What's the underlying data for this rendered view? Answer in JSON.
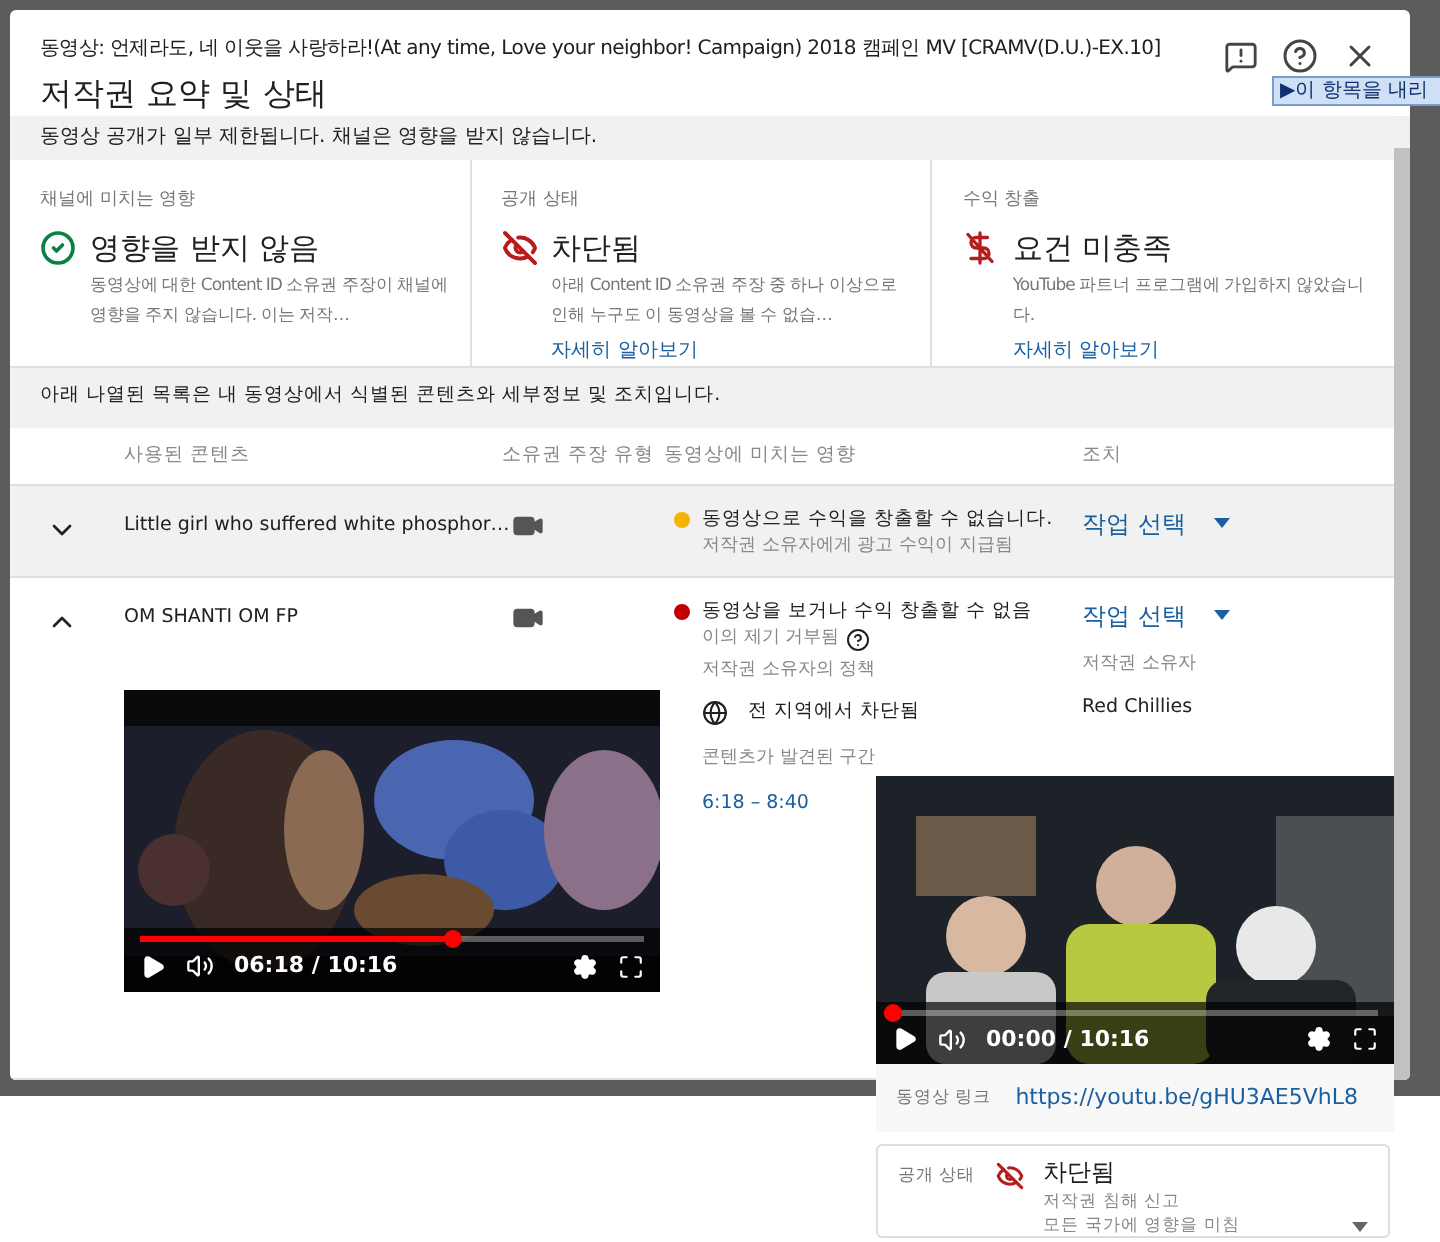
{
  "dialog": {
    "subtitle": "동영상: 언제라도, 네 이웃을 사랑하라!(At any time, Love your neighbor! Campaign) 2018 캠페인 MV [CRAMV(D.U.)-EX.10]",
    "title": "저작권 요약 및 상태"
  },
  "tooltip": "▶이 항목을 내리",
  "notice": "동영상 공개가 일부 제한됩니다. 채널은 영향을 받지 않습니다.",
  "summary_cards": [
    {
      "kind": "ok",
      "label": "채널에 미치는 영향",
      "status": "영향을 받지 않음",
      "description": "동영상에 대한 Content ID 소유권 주장이 채널에 영향을 주지 않습니다. 이는 저작…"
    },
    {
      "kind": "blocked",
      "label": "공개 상태",
      "status": "차단됨",
      "description": "아래 Content ID 소유권 주장 중 하나 이상으로 인해 누구도 이 동영상을 볼 수 없습…",
      "link": "자세히 알아보기"
    },
    {
      "kind": "money",
      "label": "수익 창출",
      "status": "요건 미충족",
      "description": "YouTube 파트너 프로그램에 가입하지 않았습니다.",
      "link": "자세히 알아보기"
    }
  ],
  "list_intro": "아래 나열된 목록은 내 동영상에서 식별된 콘텐츠와 세부정보 및 조치입니다.",
  "table": {
    "columns": [
      "사용된 콘텐츠",
      "소유권 주장 유형",
      "동영상에 미치는 영향",
      "조치"
    ],
    "rows": [
      {
        "expanded": false,
        "highlighted": true,
        "content": "Little girl who suffered white phosphor…",
        "impact": "동영상으로 수익을 창출할 수 없습니다.",
        "impact_detail": "저작권 소유자에게 광고 수익이 지급됨",
        "color": "#f4b400",
        "action": "작업 선택"
      },
      {
        "expanded": true,
        "highlighted": false,
        "content": "OM SHANTI OM FP",
        "impact": "동영상을 보거나 수익 창출할 수 없음",
        "impact_detail": "이의 제기 거부됨",
        "color": "#c00000",
        "action": "작업 선택",
        "details": {
          "policy_label": "저작권 소유자의 정책",
          "policy": "전 지역에서 차단됨",
          "owner_label": "저작권 소유자",
          "owner": "Red Chillies",
          "segment_label": "콘텐츠가 발견된 구간",
          "segment": "6:18 – 8:40",
          "player": {
            "time": "06:18 / 10:16",
            "level": 0.62
          }
        }
      }
    ]
  },
  "overlay": {
    "player": {
      "time": "00:00 / 10:16",
      "level": 0
    },
    "link_label": "동영상 링크",
    "link": "https://youtu.be/gHU3AE5VhL8",
    "status_label": "공개 상태",
    "status": "차단됨",
    "status_detail": [
      "저작권 침해 신고",
      "모든 국가에 영향을 미침"
    ]
  }
}
